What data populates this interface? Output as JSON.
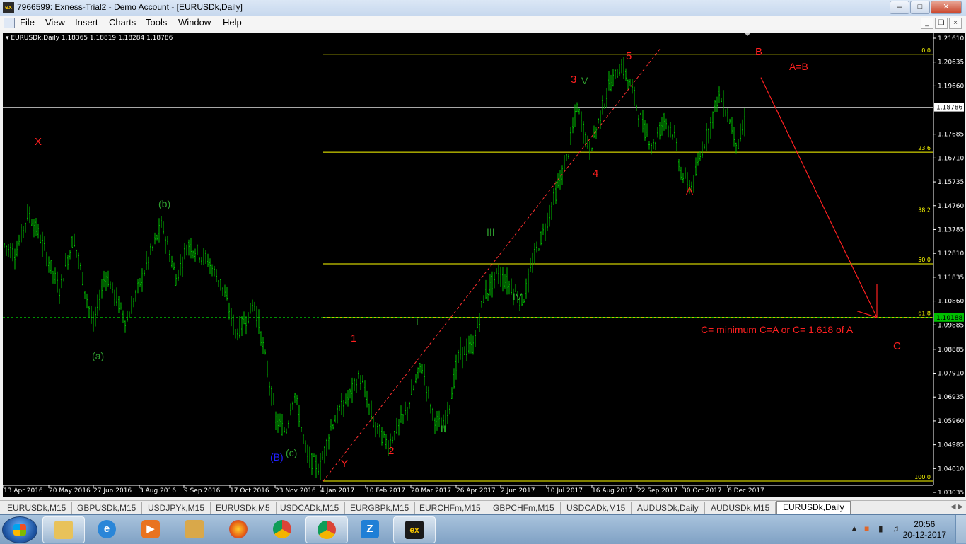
{
  "window": {
    "title": "7966599: Exness-Trial2 - Demo Account - [EURUSDk,Daily]",
    "app_icon": "exness-icon",
    "buttons": [
      "minimize",
      "maximize",
      "close"
    ]
  },
  "menu": [
    "File",
    "View",
    "Insert",
    "Charts",
    "Tools",
    "Window",
    "Help"
  ],
  "chart": {
    "header": "EURUSDk,Daily  1.18365 1.18819 1.18284 1.18786",
    "colors": {
      "background": "#000000",
      "candles": "#00c000",
      "fib": "#ffff00",
      "annotation_red": "#ff2020",
      "annotation_green": "#2fa02f",
      "annotation_blue": "#2020ff"
    },
    "price_axis": [
      "1.21610",
      "1.20635",
      "1.19660",
      "1.18786",
      "1.17685",
      "1.16710",
      "1.15735",
      "1.14760",
      "1.13785",
      "1.12810",
      "1.11835",
      "1.10860",
      "1.10188",
      "1.09885",
      "1.08885",
      "1.07910",
      "1.06935",
      "1.05960",
      "1.04985",
      "1.04010",
      "1.03035"
    ],
    "current_price_label": "1.18786",
    "line_price_label": "1.10188",
    "date_axis": [
      "13 Apr 2016",
      "20 May 2016",
      "27 Jun 2016",
      "3 Aug 2016",
      "9 Sep 2016",
      "17 Oct 2016",
      "23 Nov 2016",
      "4 Jan 2017",
      "10 Feb 2017",
      "20 Mar 2017",
      "26 Apr 2017",
      "2 Jun 2017",
      "10 Jul 2017",
      "16 Aug 2017",
      "22 Sep 2017",
      "30 Oct 2017",
      "6 Dec 2017"
    ],
    "fib_levels": [
      {
        "label": "0.0",
        "price": 1.2095
      },
      {
        "label": "23.6",
        "price": 1.1695
      },
      {
        "label": "38.2",
        "price": 1.1442
      },
      {
        "label": "50.0",
        "price": 1.1238
      },
      {
        "label": "61.8",
        "price": 1.1019
      },
      {
        "label": "100.0",
        "price": 1.035
      }
    ],
    "annotations": {
      "X": "X",
      "a_small": "(a)",
      "b_small": "(b)",
      "c_small": "(c)",
      "B_paren": "(B)",
      "Y": "Y",
      "w1": "1",
      "w2": "2",
      "w3": "3",
      "w4": "4",
      "w5": "5",
      "r1": "I",
      "r2": "II",
      "r3": "III",
      "r4": "IV",
      "r5": "V",
      "A": "A",
      "B": "B",
      "C": "C",
      "AeqB": "A=B",
      "note": "C= minimum C=A or C= 1.618 of A"
    }
  },
  "tabs": {
    "items": [
      "EURUSDk,M15",
      "GBPUSDk,M15",
      "USDJPYk,M15",
      "EURUSDk,M5",
      "USDCADk,M15",
      "EURGBPk,M15",
      "EURCHFm,M15",
      "GBPCHFm,M15",
      "USDCADk,M15",
      "AUDUSDk,Daily",
      "AUDUSDk,M15",
      "EURUSDk,Daily"
    ],
    "active_index": 11
  },
  "taskbar": {
    "apps": [
      "explorer-icon",
      "ie-icon",
      "media-player-icon",
      "network-folder-icon",
      "firefox-icon",
      "chrome-icon",
      "chrome-icon",
      "zoom-icon",
      "exness-terminal-icon"
    ],
    "time": "20:56",
    "date": "20-12-2017"
  }
}
